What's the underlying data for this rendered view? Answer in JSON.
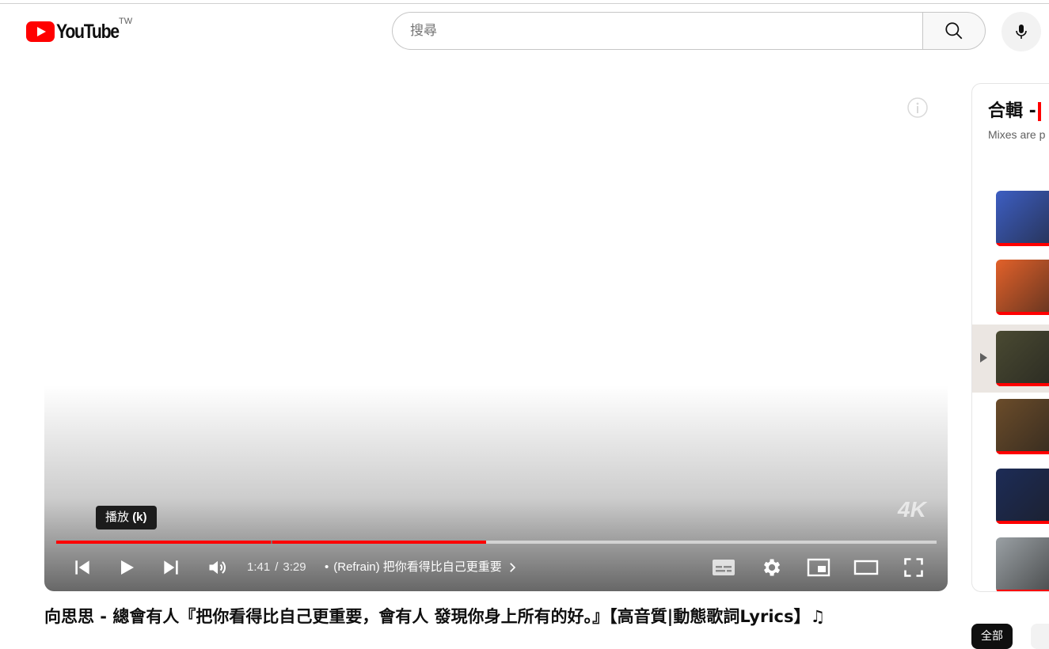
{
  "masthead": {
    "logo_text": "YouTube",
    "region_code": "TW",
    "search_placeholder": "搜尋",
    "search_icon": "search-icon",
    "mic_icon": "mic-icon"
  },
  "player": {
    "tooltip_label": "播放",
    "tooltip_shortcut": "(k)",
    "current_time": "1:41",
    "duration": "3:29",
    "chapter_separator": "•",
    "chapter_title": "(Refrain) 把你看得比自己更重要",
    "played_fraction": 0.488,
    "loaded_fraction": 0.488,
    "chapter_break_fraction": 0.244,
    "quality_badge": "4K",
    "icons": [
      "info-icon",
      "previous-icon",
      "play-icon",
      "next-icon",
      "volume-icon",
      "subtitles-icon",
      "settings-icon",
      "miniplayer-icon",
      "theater-icon",
      "fullscreen-icon",
      "chevron-right-icon"
    ]
  },
  "video": {
    "title": "向思思 - 總會有人『把你看得比自己更重要，會有人 發現你身上所有的好。』【高音質|動態歌詞Lyrics】♫"
  },
  "playlist": {
    "title": "合輯 -",
    "subtitle": "Mixes are p",
    "active_index": 2,
    "items": [
      {
        "thumb": "#3d5ec2"
      },
      {
        "thumb": "#e2612a"
      },
      {
        "thumb": "#4a4a32"
      },
      {
        "thumb": "#6b4c2a"
      },
      {
        "thumb": "#1d2c57"
      },
      {
        "thumb": "#9aa0a4"
      }
    ]
  },
  "chips": {
    "all": "全部"
  },
  "colors": {
    "brand_red": "#ff0000",
    "text_primary": "#0f0f0f",
    "text_secondary": "#606060"
  }
}
